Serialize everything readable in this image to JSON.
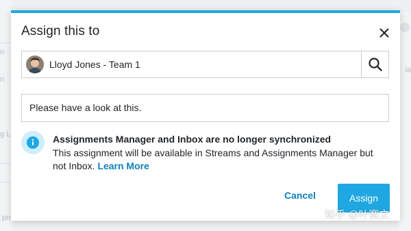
{
  "modal": {
    "title": "Assign this to",
    "assignee": {
      "name": "Lloyd Jones - Team 1"
    },
    "message": {
      "value": "Please have a look at this."
    },
    "notice": {
      "title": "Assignments Manager and Inbox are no longer synchronized",
      "body": "This assignment will be available in Streams and Assignments Manager but not Inbox.",
      "link": "Learn More"
    },
    "buttons": {
      "cancel": "Cancel",
      "assign": "Assign"
    }
  },
  "watermark": "知乎 @叶赛文",
  "colors": {
    "accent": "#1ea7e1",
    "link": "#0e7fb8",
    "info_bg": "#cdeefc"
  },
  "icons": [
    "close-icon",
    "search-icon",
    "info-icon",
    "avatar"
  ]
}
